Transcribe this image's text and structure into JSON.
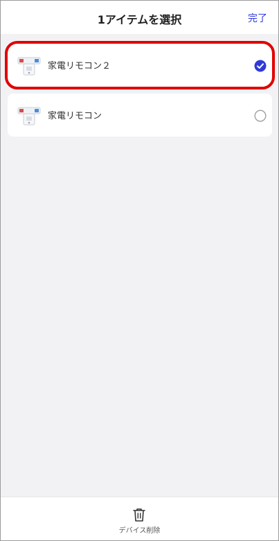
{
  "header": {
    "title": "1アイテムを選択",
    "done_label": "完了"
  },
  "devices": [
    {
      "name": "家電リモコン２",
      "selected": true,
      "icon": "remote-device-icon"
    },
    {
      "name": "家電リモコン",
      "selected": false,
      "icon": "remote-device-icon"
    }
  ],
  "footer": {
    "delete_label": "デバイス削除",
    "icon": "trash-icon"
  },
  "colors": {
    "accent": "#2f3ad6",
    "highlight": "#e10000",
    "background": "#f2f2f4"
  }
}
